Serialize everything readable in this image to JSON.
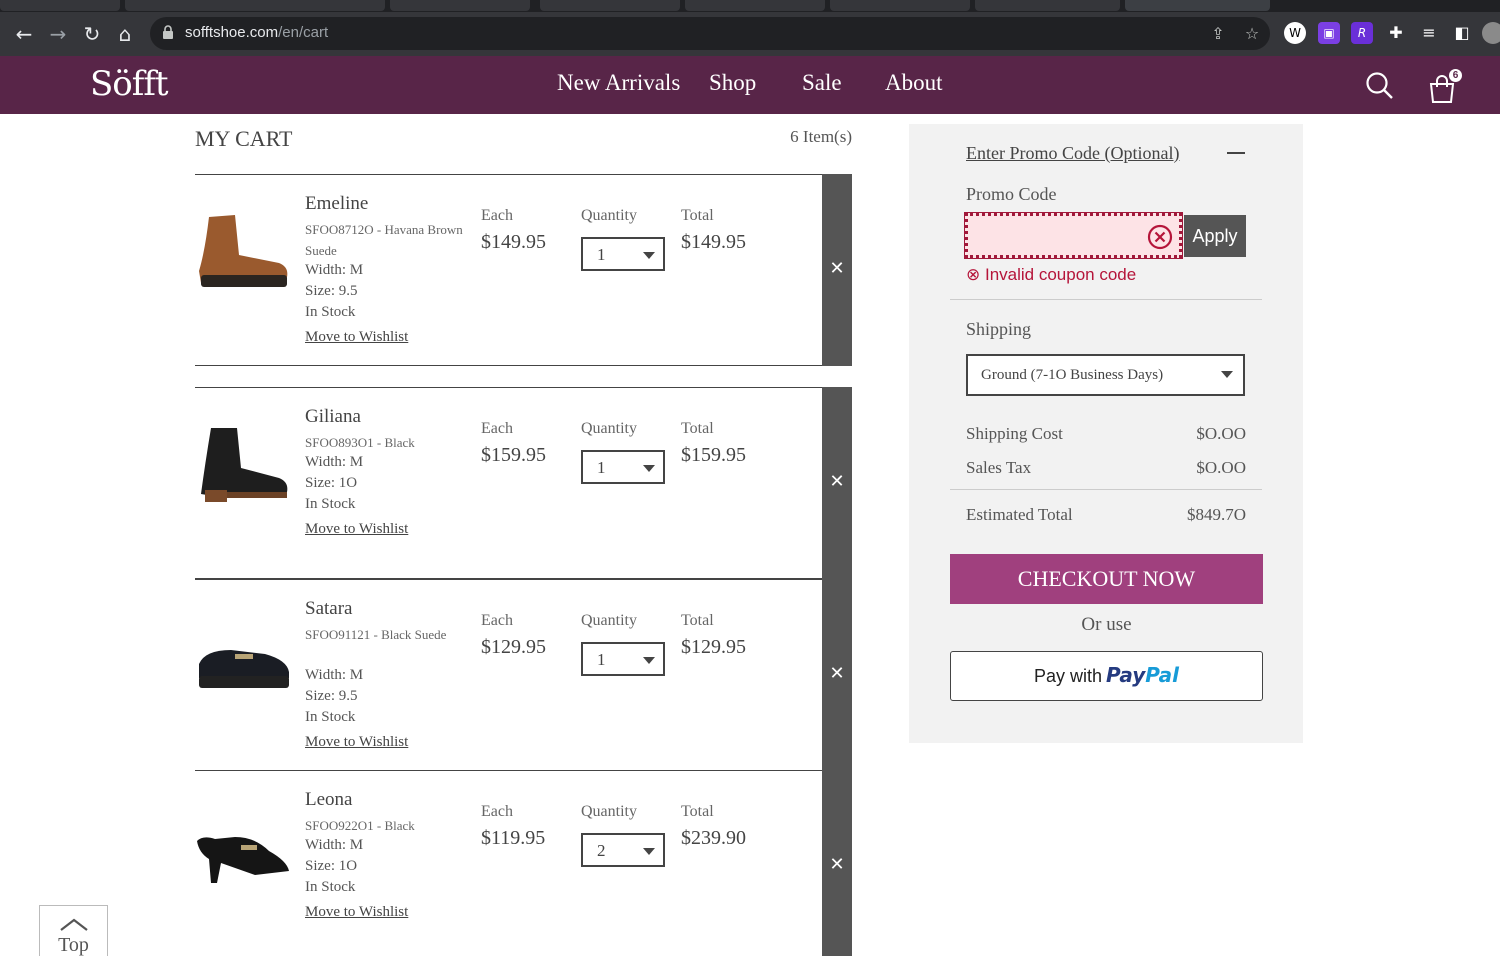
{
  "browser": {
    "url_host": "sofftshoe.com",
    "url_path": "/en/cart"
  },
  "header": {
    "logo": "Söfft",
    "nav": [
      "New Arrivals",
      "Shop",
      "Sale",
      "About"
    ],
    "cart_count": "6"
  },
  "cart": {
    "title": "MY CART",
    "item_count": "6 Item(s)",
    "labels": {
      "each": "Each",
      "quantity": "Quantity",
      "total": "Total",
      "wishlist": "Move to Wishlist"
    },
    "items": [
      {
        "name": "Emeline",
        "sku": "SFOO8712O - Havana Brown Suede",
        "width": "Width: M",
        "size": "Size: 9.5",
        "stock": "In Stock",
        "each": "$149.95",
        "qty": "1",
        "total": "$149.95",
        "color": "#9a5a2e"
      },
      {
        "name": "Giliana",
        "sku": "SFOO893O1 - Black",
        "width": "Width: M",
        "size": "Size: 1O",
        "stock": "In Stock",
        "each": "$159.95",
        "qty": "1",
        "total": "$159.95",
        "color": "#1e1e1e"
      },
      {
        "name": "Satara",
        "sku": "SFOO91121 - Black Suede",
        "width": "Width: M",
        "size": "Size: 9.5",
        "stock": "In Stock",
        "each": "$129.95",
        "qty": "1",
        "total": "$129.95",
        "color": "#1a1d24"
      },
      {
        "name": "Leona",
        "sku": "SFOO922O1 - Black",
        "width": "Width: M",
        "size": "Size: 1O",
        "stock": "In Stock",
        "each": "$119.95",
        "qty": "2",
        "total": "$239.90",
        "color": "#151515"
      }
    ]
  },
  "summary": {
    "promo_toggle": "Enter Promo Code (Optional)",
    "promo_label": "Promo Code",
    "promo_value": "",
    "apply": "Apply",
    "error": "⊗ Invalid coupon code",
    "shipping_label": "Shipping",
    "shipping_value": "Ground (7-1O Business Days)",
    "shipping_cost_label": "Shipping Cost",
    "shipping_cost": "$O.OO",
    "sales_tax_label": "Sales Tax",
    "sales_tax": "$O.OO",
    "estimated_total_label": "Estimated Total",
    "estimated_total": "$849.7O",
    "checkout": "CHECKOUT NOW",
    "or_use": "Or use",
    "paypal_prefix": "Pay with",
    "paypal_brand_1": "Pay",
    "paypal_brand_2": "Pal"
  },
  "back_to_top": "Top",
  "colors": {
    "brand": "#582548",
    "checkout": "#a0407e",
    "error": "#b5153a"
  }
}
